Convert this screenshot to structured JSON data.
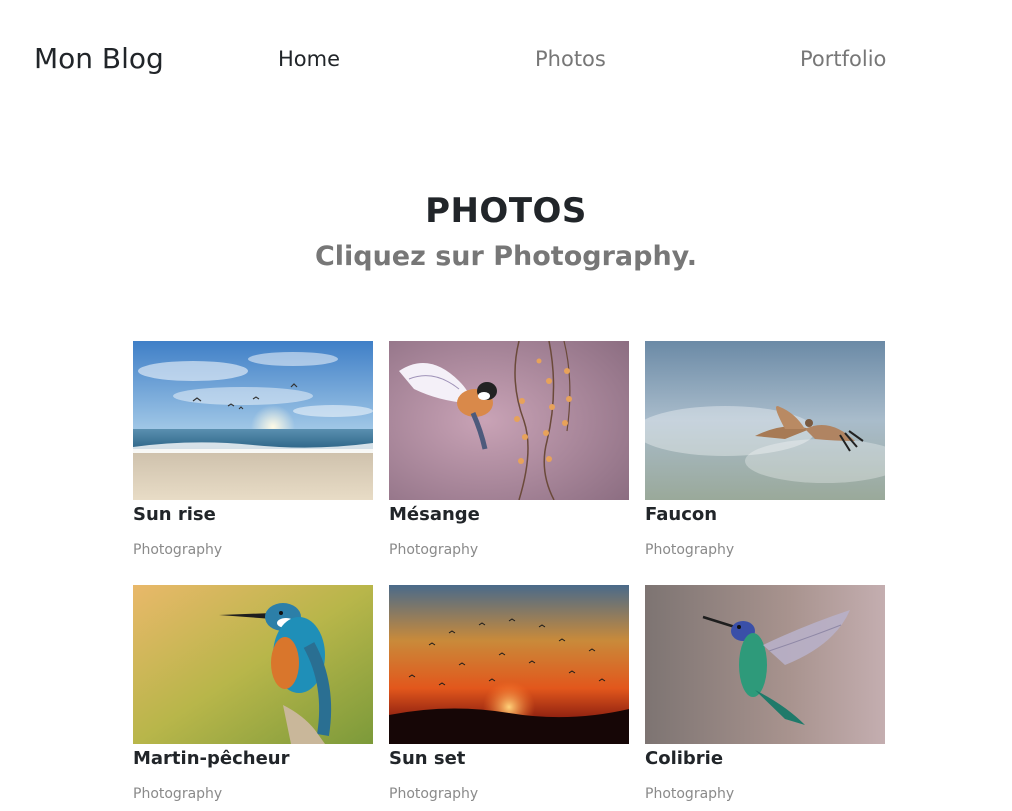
{
  "nav": {
    "brand": "Mon Blog",
    "links": [
      "Home",
      "Photos",
      "Portfolio"
    ]
  },
  "header": {
    "title": "PHOTOS",
    "subtitle": "Cliquez sur Photography."
  },
  "gallery": {
    "items": [
      {
        "title": "Sun rise",
        "category": "Photography",
        "image": "beach-sunrise-with-birds"
      },
      {
        "title": "Mésange",
        "category": "Photography",
        "image": "titmouse-in-flight"
      },
      {
        "title": "Faucon",
        "category": "Photography",
        "image": "falcon-in-flight"
      },
      {
        "title": "Martin-pêcheur",
        "category": "Photography",
        "image": "kingfisher-perched"
      },
      {
        "title": "Sun set",
        "category": "Photography",
        "image": "sunset-with-birds"
      },
      {
        "title": "Colibrie",
        "category": "Photography",
        "image": "hummingbird-hovering"
      }
    ]
  }
}
